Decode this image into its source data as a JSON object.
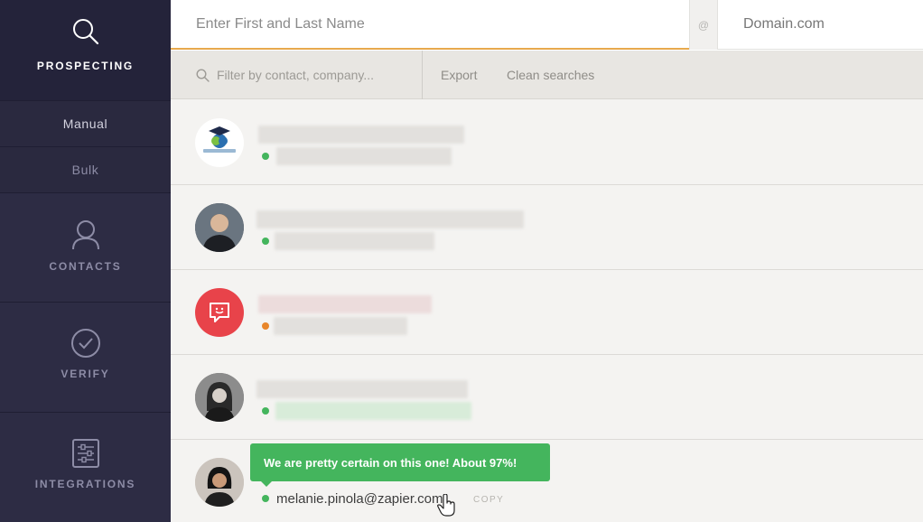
{
  "sidebar": {
    "prospecting": {
      "label": "PROSPECTING",
      "icon": "search-icon"
    },
    "manual": {
      "label": "Manual"
    },
    "bulk": {
      "label": "Bulk"
    },
    "contacts": {
      "label": "CONTACTS",
      "icon": "user-icon"
    },
    "verify": {
      "label": "VERIFY",
      "icon": "check-circle-icon"
    },
    "integrations": {
      "label": "INTEGRATIONS",
      "icon": "integrations-icon"
    }
  },
  "search": {
    "name_placeholder": "Enter First and Last Name",
    "at_symbol": "@",
    "domain_placeholder": "Domain.com"
  },
  "filterbar": {
    "filter_placeholder": "Filter by contact, company...",
    "export_label": "Export",
    "clean_label": "Clean searches"
  },
  "contacts": {
    "last": {
      "email": "melanie.pinola@zapier.com",
      "copy_label": "COPY",
      "tooltip": "We are pretty certain on this one! About 97%!"
    }
  },
  "colors": {
    "sidebar_bg": "#2d2c44",
    "accent_orange": "#e8a94d",
    "status_green": "#44b55d",
    "status_orange": "#e8862a",
    "red_avatar": "#e8434a"
  }
}
